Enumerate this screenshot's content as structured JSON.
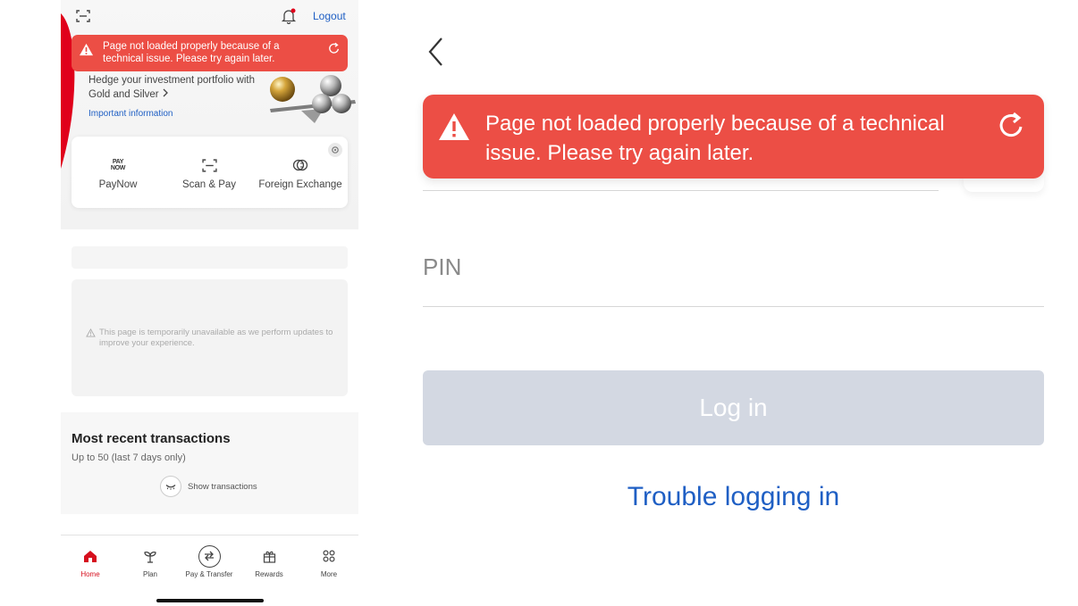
{
  "left_app": {
    "header": {
      "logout_label": "Logout"
    },
    "error_banner": {
      "message": "Page not loaded properly because of a technical issue. Please try again later."
    },
    "promo": {
      "line1": "Hedge your investment portfolio with",
      "line2": "Gold and Silver",
      "important_info": "Important information"
    },
    "quick_actions": [
      {
        "label": "PayNow",
        "icon": "paynow-icon",
        "logo_top": "PAY",
        "logo_bottom": "NOW"
      },
      {
        "label": "Scan & Pay",
        "icon": "scan-icon"
      },
      {
        "label": "Foreign Exchange",
        "icon": "fx-icon"
      }
    ],
    "unavailable_notice": "This page is temporarily unavailable as we perform updates to improve your experience.",
    "recent_transactions": {
      "title": "Most recent transactions",
      "subtitle": "Up to 50 (last 7 days only)",
      "show_label": "Show transactions"
    },
    "tabbar": [
      {
        "label": "Home",
        "icon": "home-icon",
        "active": true
      },
      {
        "label": "Plan",
        "icon": "plant-icon",
        "active": false
      },
      {
        "label": "Pay & Transfer",
        "icon": "transfer-icon",
        "active": false
      },
      {
        "label": "Rewards",
        "icon": "gift-icon",
        "active": false
      },
      {
        "label": "More",
        "icon": "grid-icon",
        "active": false
      }
    ]
  },
  "right_login": {
    "error_banner": {
      "message": "Page not loaded properly because of a technical issue. Please try again later."
    },
    "pin_label": "PIN",
    "login_button": "Log in",
    "trouble_link": "Trouble logging in"
  },
  "colors": {
    "error_red": "#ec4e45",
    "brand_red": "#d60f1e",
    "link_blue": "#1f5fc4",
    "disabled_button": "#d3d8e2"
  }
}
